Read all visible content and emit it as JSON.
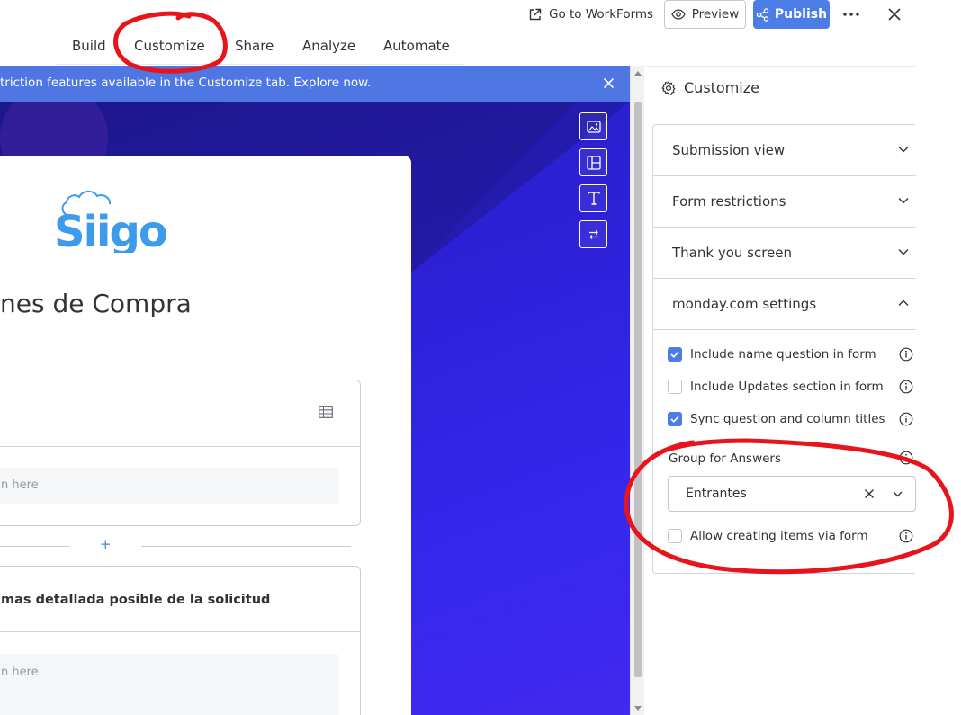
{
  "header": {
    "tabs": [
      {
        "label": "Build"
      },
      {
        "label": "Customize"
      },
      {
        "label": "Share"
      },
      {
        "label": "Analyze"
      },
      {
        "label": "Automate"
      }
    ],
    "goto_label": "Go to WorkForms",
    "preview_label": "Preview",
    "publish_label": "Publish"
  },
  "banner": {
    "text": "triction features available in the Customize tab. Explore now."
  },
  "form": {
    "logo_text": "Siigo",
    "title": "nes de Compra",
    "question1": {
      "placeholder": "n here"
    },
    "question2": {
      "title": "mas detallada posible de la solicitud",
      "placeholder": "n here"
    },
    "add_symbol": "+"
  },
  "panel": {
    "title": "Customize",
    "sections": [
      {
        "label": "Submission view",
        "expanded": false
      },
      {
        "label": "Form restrictions",
        "expanded": false
      },
      {
        "label": "Thank you screen",
        "expanded": false
      },
      {
        "label": "monday.com settings",
        "expanded": true
      }
    ],
    "options": [
      {
        "label": "Include name question in form",
        "checked": true
      },
      {
        "label": "Include Updates section in form",
        "checked": false
      },
      {
        "label": "Sync question and column titles",
        "checked": true
      }
    ],
    "group_label": "Group for Answers",
    "group_value": "Entrantes",
    "allow_option": {
      "label": "Allow creating items via form",
      "checked": false
    }
  },
  "colors": {
    "accent": "#4c7de6",
    "banner": "#4f77e3",
    "annotation": "#e8141c"
  }
}
